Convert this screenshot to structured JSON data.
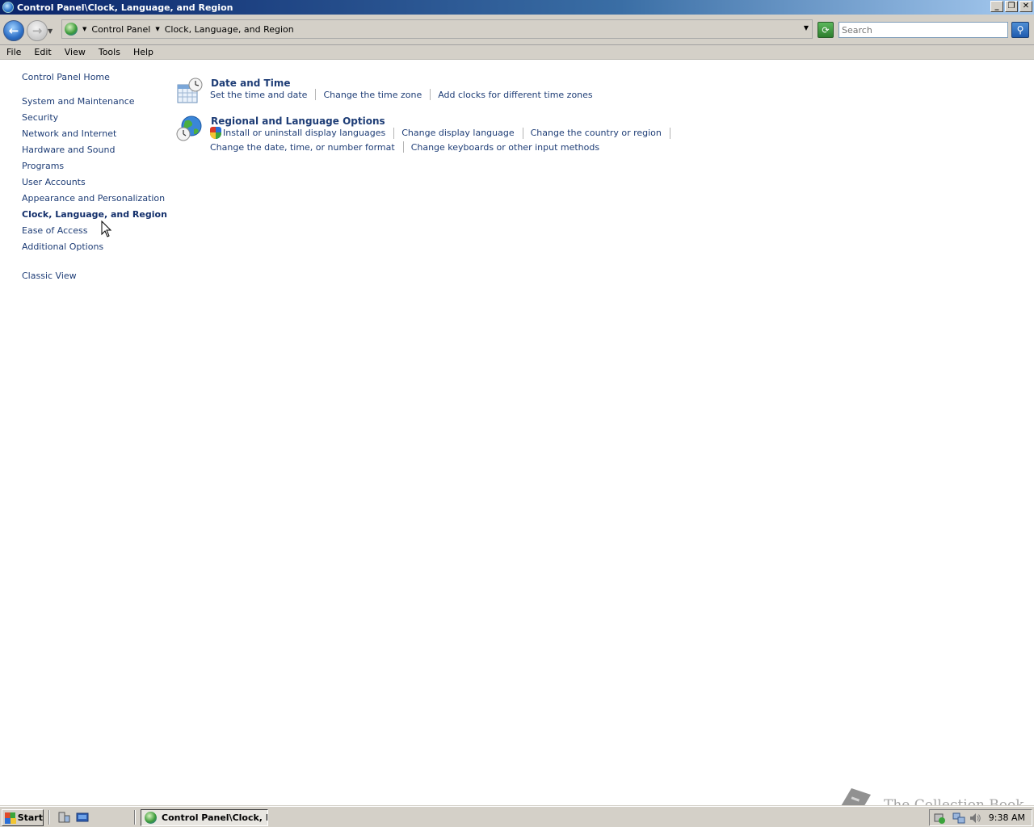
{
  "window": {
    "title": "Control Panel\\Clock, Language, and Region"
  },
  "address_bar": {
    "crumbs": [
      "Control Panel",
      "Clock, Language, and Region"
    ],
    "search_placeholder": "Search"
  },
  "menu": [
    "File",
    "Edit",
    "View",
    "Tools",
    "Help"
  ],
  "left_nav": {
    "home": "Control Panel Home",
    "items": [
      "System and Maintenance",
      "Security",
      "Network and Internet",
      "Hardware and Sound",
      "Programs",
      "User Accounts",
      "Appearance and Personalization",
      "Clock, Language, and Region",
      "Ease of Access",
      "Additional Options"
    ],
    "active": "Clock, Language, and Region",
    "classic_view": "Classic View"
  },
  "categories": [
    {
      "title": "Date and Time",
      "icon": "calendar-clock-icon",
      "tasks": [
        "Set the time and date",
        "Change the time zone",
        "Add clocks for different time zones"
      ]
    },
    {
      "title": "Regional and Language Options",
      "icon": "globe-clock-icon",
      "tasks_row1": [
        "Install or uninstall display languages",
        "Change display language",
        "Change the country or region"
      ],
      "tasks_row2": [
        "Change the date, time, or number format",
        "Change keyboards or other input methods"
      ]
    }
  ],
  "taskbar": {
    "start_label": "Start",
    "window_button": "Control Panel\\Clock, L...",
    "clock": "9:38 AM"
  },
  "watermark": "The Collection Book"
}
